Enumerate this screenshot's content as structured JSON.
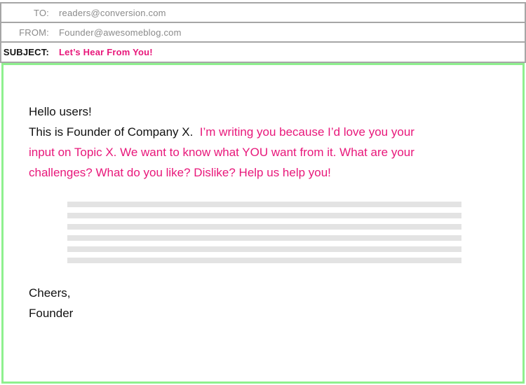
{
  "email": {
    "to_label": "TO:",
    "to_value": "readers@conversion.com",
    "from_label": "FROM:",
    "from_value": "Founder@awesomeblog.com",
    "subject_label": "SUBJECT:",
    "subject_value": "Let’s Hear From You!"
  },
  "body": {
    "greeting": "Hello users!",
    "intro": "This is Founder of Company X.",
    "highlight_line1": "I’m writing you because I’d love you your",
    "highlight_line2": "input on Topic X.  We want to know what YOU want from it.  What are your",
    "highlight_line3": "challenges?  What do you like?  Dislike?  Help us help you!",
    "placeholder_line_count": 6,
    "signoff_line1": "Cheers,",
    "signoff_line2": "Founder"
  },
  "colors": {
    "accent": "#e8177a",
    "frame_border": "#8ef08e",
    "header_border": "#a6a6a6",
    "placeholder": "#e3e3e3"
  }
}
